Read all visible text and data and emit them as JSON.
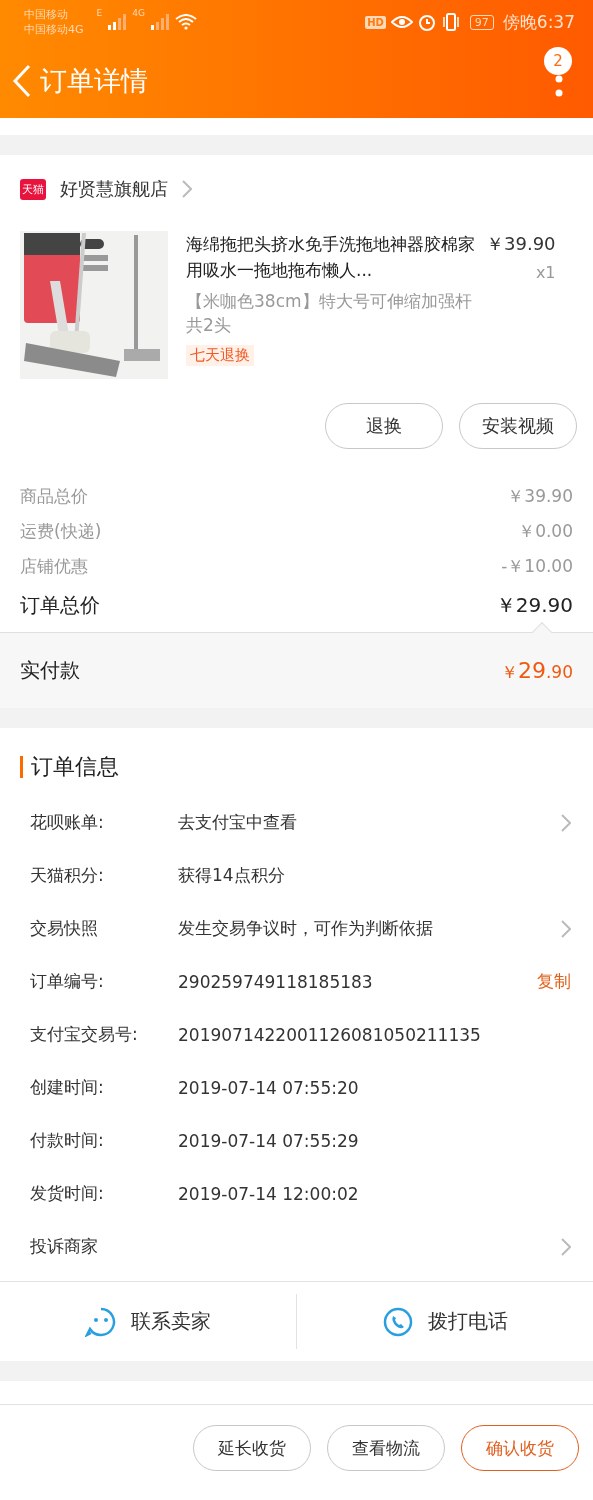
{
  "status_bar": {
    "carrier_1": "中国移动",
    "carrier_2": "中国移动4G",
    "net_1": "E",
    "net_2": "4G",
    "hd": "HD",
    "battery": "97",
    "time": "傍晚6:37"
  },
  "header": {
    "title": "订单详情",
    "badge": "2"
  },
  "store": {
    "name": "好贤慧旗舰店",
    "logo": "天猫"
  },
  "product": {
    "kind": "picture",
    "title": "海绵拖把头挤水免手洗拖地神器胶棉家用吸水一拖地拖布懒人...",
    "price": "￥39.90",
    "quantity": "x1",
    "sku": "【米咖色38cm】特大号可伸缩加强杆共2头",
    "tag": "七天退换"
  },
  "item_buttons": [
    "退换",
    "安装视频"
  ],
  "price_rows": [
    {
      "label": "商品总价",
      "value": "￥39.90",
      "kind": "minor"
    },
    {
      "label": "运费(快递)",
      "value": "￥0.00",
      "kind": "minor"
    },
    {
      "label": "店铺优惠",
      "value": "-￥10.00",
      "kind": "minor"
    },
    {
      "label": "订单总价",
      "value": "￥29.90",
      "kind": "total"
    }
  ],
  "paid": {
    "label": "实付款",
    "currency": "￥",
    "integer": "29",
    "decimal": ".90"
  },
  "order_info": {
    "title": "订单信息",
    "rows": [
      {
        "label": "花呗账单:",
        "value": "去支付宝中查看",
        "kind": "chevron"
      },
      {
        "label": "天猫积分:",
        "value": "获得14点积分",
        "kind": "plain"
      },
      {
        "label": "交易快照",
        "value": "发生交易争议时，可作为判断依据",
        "kind": "chevron"
      },
      {
        "label": "订单编号:",
        "value": "290259749118185183",
        "kind": "copy",
        "action": "复制"
      },
      {
        "label": "支付宝交易号:",
        "value": "2019071422001126081050211135",
        "kind": "plain"
      },
      {
        "label": "创建时间:",
        "value": "2019-07-14 07:55:20",
        "kind": "plain"
      },
      {
        "label": "付款时间:",
        "value": "2019-07-14 07:55:29",
        "kind": "plain"
      },
      {
        "label": "发货时间:",
        "value": "2019-07-14 12:00:02",
        "kind": "plain"
      },
      {
        "label": "投诉商家",
        "value": "",
        "kind": "chevron"
      }
    ]
  },
  "contact": [
    {
      "label": "联系卖家",
      "kind": "chat"
    },
    {
      "label": "拨打电话",
      "kind": "phone"
    }
  ],
  "bottom_buttons": [
    {
      "label": "延长收货",
      "kind": "normal"
    },
    {
      "label": "查看物流",
      "kind": "normal"
    },
    {
      "label": "确认收货",
      "kind": "primary"
    }
  ]
}
